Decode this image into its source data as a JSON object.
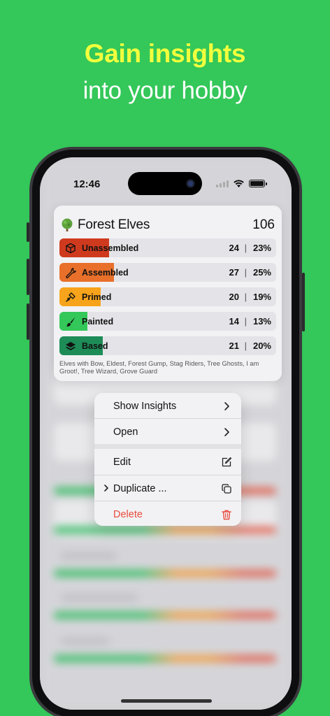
{
  "header": {
    "headline": "Gain insights",
    "subline": "into your hobby"
  },
  "status_bar": {
    "time": "12:46"
  },
  "card": {
    "title": "Forest Elves",
    "total": "106",
    "rows": [
      {
        "label": "Unassembled",
        "count": "24",
        "separator": "|",
        "percent": "23%",
        "fill": 0.23,
        "color": "#cf3a1e",
        "icon": "cube-icon"
      },
      {
        "label": "Assembled",
        "count": "27",
        "separator": "|",
        "percent": "25%",
        "fill": 0.25,
        "color": "#e8702a",
        "icon": "wrench-icon"
      },
      {
        "label": "Primed",
        "count": "20",
        "separator": "|",
        "percent": "19%",
        "fill": 0.19,
        "color": "#f7a31b",
        "icon": "spray-icon"
      },
      {
        "label": "Painted",
        "count": "14",
        "separator": "|",
        "percent": "13%",
        "fill": 0.13,
        "color": "#34c759",
        "icon": "brush-icon"
      },
      {
        "label": "Based",
        "count": "21",
        "separator": "|",
        "percent": "20%",
        "fill": 0.2,
        "color": "#1e8c57",
        "icon": "layers-icon"
      }
    ],
    "description": "Elves with Bow, Eldest, Forest Gump, Stag Riders, Tree Ghosts, I am Groot!, Tree Wizard, Grove Guard"
  },
  "menu": {
    "show_insights": "Show Insights",
    "open": "Open",
    "edit": "Edit",
    "duplicate": "Duplicate ...",
    "delete": "Delete"
  },
  "colors": {
    "background": "#34c759",
    "headline": "#f2ff3d",
    "delete": "#e84b3c"
  }
}
